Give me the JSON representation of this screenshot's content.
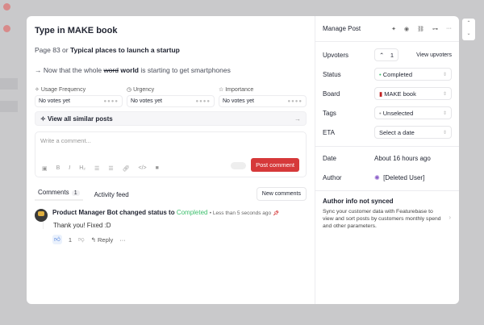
{
  "post": {
    "title": "Type in MAKE book",
    "line1_prefix": "Page 83 or ",
    "line1_bold": "Typical places to launch a startup",
    "line2_prefix": "→ Now that the whole ",
    "line2_struck": "word",
    "line2_bold": "world",
    "line2_suffix": " is starting to get smartphones"
  },
  "votes": [
    {
      "label": "Usage Frequency",
      "icon": "sparkle-icon",
      "value": "No votes yet"
    },
    {
      "label": "Urgency",
      "icon": "clock-icon",
      "value": "No votes yet"
    },
    {
      "label": "Importance",
      "icon": "star-icon",
      "value": "No votes yet"
    }
  ],
  "similar": "View all similar posts",
  "editor": {
    "placeholder": "Write a comment...",
    "submit": "Post comment"
  },
  "tabs": {
    "comments": "Comments",
    "count": "1",
    "activity": "Activity feed",
    "sort": "New comments"
  },
  "comment": {
    "author": "Product Manager Bot",
    "action": " changed status to ",
    "status": "Completed",
    "time": "Less than 5 seconds ago",
    "body": "Thank you! Fixed :D",
    "likes": "1",
    "reply": "Reply"
  },
  "panel": {
    "title": "Manage Post",
    "upvoters_label": "Upvoters",
    "upvotes": "1",
    "view_upvoters": "View upvoters",
    "status_label": "Status",
    "status": "Completed",
    "board_label": "Board",
    "board": "MAKE book",
    "tags_label": "Tags",
    "tags": "Unselected",
    "eta_label": "ETA",
    "eta": "Select a date",
    "date_label": "Date",
    "date": "About 16 hours ago",
    "author_label": "Author",
    "author": "[Deleted User]",
    "sync_title": "Author info not synced",
    "sync_text": "Sync your customer data with Featurebase to view and sort posts by customers monthly spend and other parameters."
  },
  "colors": {
    "accent": "#d6393a",
    "completed": "#3cbf6c"
  }
}
